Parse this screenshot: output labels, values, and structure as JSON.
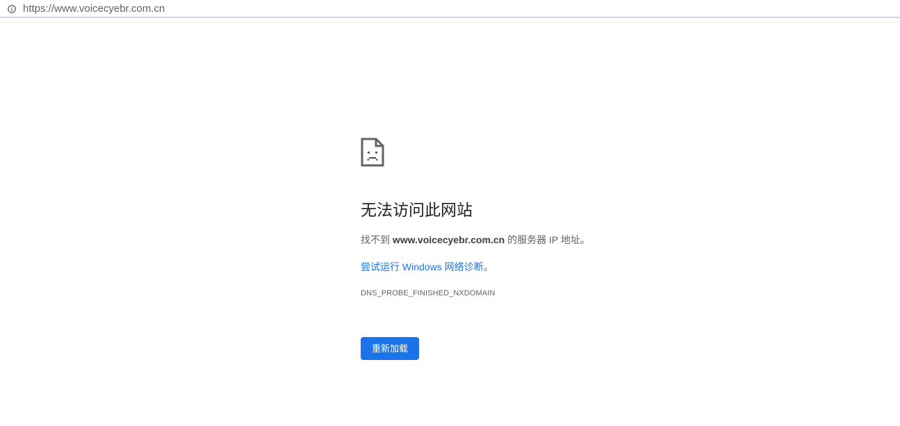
{
  "address_bar": {
    "url": "https://www.voicecyebr.com.cn",
    "icon": "info-icon"
  },
  "error_page": {
    "icon": "sad-page-icon",
    "heading": "无法访问此网站",
    "desc_prefix": "找不到 ",
    "domain": "www.voicecyebr.com.cn",
    "desc_suffix": " 的服务器 IP 地址。",
    "diagnostics_link": "尝试运行 Windows 网络诊断",
    "diagnostics_period": "。",
    "error_code": "DNS_PROBE_FINISHED_NXDOMAIN",
    "reload_button": "重新加载"
  },
  "colors": {
    "accent": "#1a73e8",
    "heading_text": "#202124",
    "body_text": "#5f6368"
  }
}
